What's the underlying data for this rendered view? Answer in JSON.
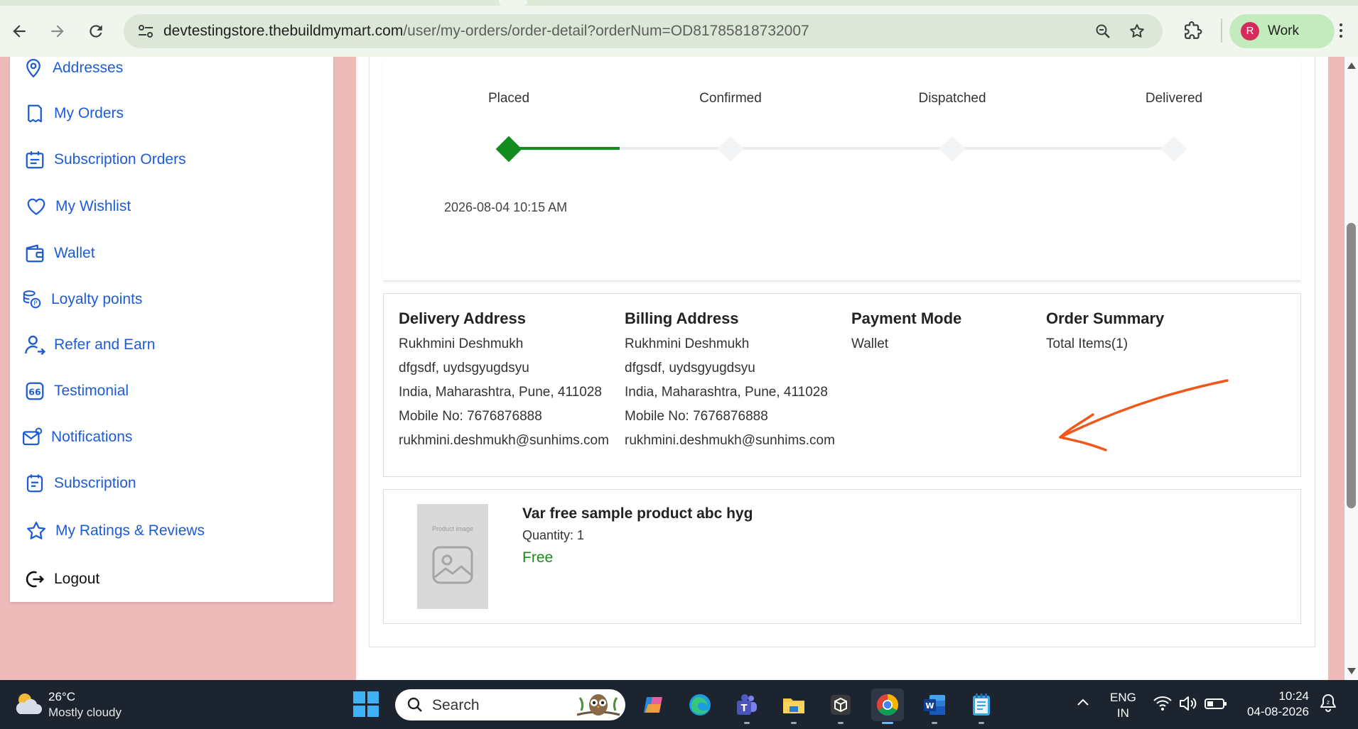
{
  "browser": {
    "url_host": "devtestingstore.thebuildmymart.com",
    "url_path": "/user/my-orders/order-detail?orderNum=OD81785818732007",
    "profile_initial": "R",
    "profile_label": "Work"
  },
  "sidebar": {
    "items": [
      {
        "label": "Addresses",
        "icon": "location-pin-icon"
      },
      {
        "label": "My Orders",
        "icon": "orders-bag-icon"
      },
      {
        "label": "Subscription Orders",
        "icon": "calendar-list-icon"
      },
      {
        "label": "My Wishlist",
        "icon": "heart-icon"
      },
      {
        "label": "Wallet",
        "icon": "wallet-icon"
      },
      {
        "label": "Loyalty points",
        "icon": "coins-icon"
      },
      {
        "label": "Refer and Earn",
        "icon": "user-share-icon"
      },
      {
        "label": "Testimonial",
        "icon": "quote-icon"
      },
      {
        "label": "Notifications",
        "icon": "envelope-icon"
      },
      {
        "label": "Subscription",
        "icon": "subscription-icon"
      },
      {
        "label": "My Ratings & Reviews",
        "icon": "star-icon"
      },
      {
        "label": "Logout",
        "icon": "logout-icon"
      }
    ]
  },
  "tracker": {
    "steps": [
      {
        "label": "Placed",
        "done": true
      },
      {
        "label": "Confirmed",
        "done": false
      },
      {
        "label": "Dispatched",
        "done": false
      },
      {
        "label": "Delivered",
        "done": false
      }
    ],
    "placed_date": "2026-08-04 10:15 AM",
    "accent_color": "#128c1c"
  },
  "delivery": {
    "title": "Delivery Address",
    "name": "Rukhmini Deshmukh",
    "line1": "dfgsdf, uydsgyugdsyu",
    "line2": "India, Maharashtra, Pune, 411028",
    "mobile": "Mobile No: 7676876888",
    "email": "rukhmini.deshmukh@sunhims.com"
  },
  "billing": {
    "title": "Billing Address",
    "name": "Rukhmini Deshmukh",
    "line1": "dfgsdf, uydsgyugdsyu",
    "line2": "India, Maharashtra, Pune, 411028",
    "mobile": "Mobile No: 7676876888",
    "email": "rukhmini.deshmukh@sunhims.com"
  },
  "payment": {
    "title": "Payment Mode",
    "value": "Wallet"
  },
  "summary": {
    "title": "Order Summary",
    "total_items": "Total Items(1)"
  },
  "product": {
    "image_label": "Product image",
    "name": "Var free sample product abc hyg",
    "quantity": "Quantity: 1",
    "price": "Free"
  },
  "taskbar": {
    "weather_temp": "26°C",
    "weather_desc": "Mostly cloudy",
    "search_label": "Search",
    "lang_line1": "ENG",
    "lang_line2": "IN",
    "time": "10:24",
    "date": "04-08-2026"
  }
}
